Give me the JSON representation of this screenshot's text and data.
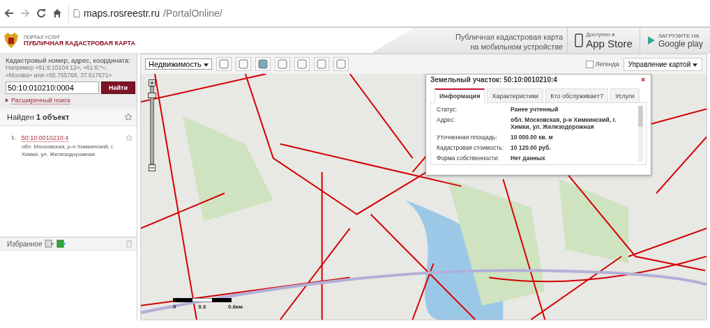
{
  "browser": {
    "url_host": "maps.rosreestr.ru",
    "url_path": "/PortalOnline/"
  },
  "header": {
    "portal": "ПОРТАЛ УСЛУГ",
    "title": "ПУБЛИЧНАЯ КАДАСТРОВАЯ КАРТА",
    "mobile_text": [
      "Публичная кадастровая карта",
      "на мобильном устройстве"
    ],
    "stores": [
      {
        "small": "Доступно в",
        "big": "App Store",
        "kind": "apple"
      },
      {
        "small": "ЗАГРУЗИТЕ НА",
        "big": "Google play",
        "kind": "google"
      }
    ]
  },
  "search": {
    "label": "Кадастровый номер, адрес, координата:",
    "hint": [
      "Например «61:6:10104:12», «61:6:*»,",
      "«Москва» или «55.755768, 37.617671»"
    ],
    "value": "50:10:010210:0004",
    "button": "Найти",
    "advanced": "Расширенный поиск"
  },
  "results": {
    "found_prefix": "Найден",
    "found_count": "1 объект",
    "items": [
      {
        "number": "1.",
        "link": "50:10:0010210:4",
        "address": "обл. Московская, р-н Химкинский, г. Химки, ул. Железодорожная"
      }
    ]
  },
  "favorites": {
    "title": "Избранное"
  },
  "toolbar": {
    "layer_select": "Недвижимость",
    "legend": {
      "label": "Легенда",
      "checked": false
    },
    "map_control": "Управление картой"
  },
  "popup": {
    "title": "Земельный участок: 50:10:0010210:4",
    "close": "×",
    "tabs": [
      {
        "label": "Информация",
        "selected": true
      },
      {
        "label": "Характеристики",
        "selected": false
      },
      {
        "label": "Кто обслуживает?",
        "selected": false
      },
      {
        "label": "Услуги",
        "selected": false
      }
    ],
    "fields": [
      {
        "label": "Статус:",
        "value": "Ранее учтенный"
      },
      {
        "label": "Адрес:",
        "value": "обл. Московская, р-н Химкинский, г. Химки, ул. Железодорожная"
      },
      {
        "label": "Уточненная площадь:",
        "value": "10 000.00 кв. м"
      },
      {
        "label": "Кадастровая стоимость:",
        "value": "10 120.00 руб."
      },
      {
        "label": "Форма собственности:",
        "value": "Нет данных"
      }
    ]
  },
  "zoom": {
    "level": 0.9
  },
  "scale": {
    "labels": [
      "0",
      "0.3",
      "0.6км"
    ]
  }
}
